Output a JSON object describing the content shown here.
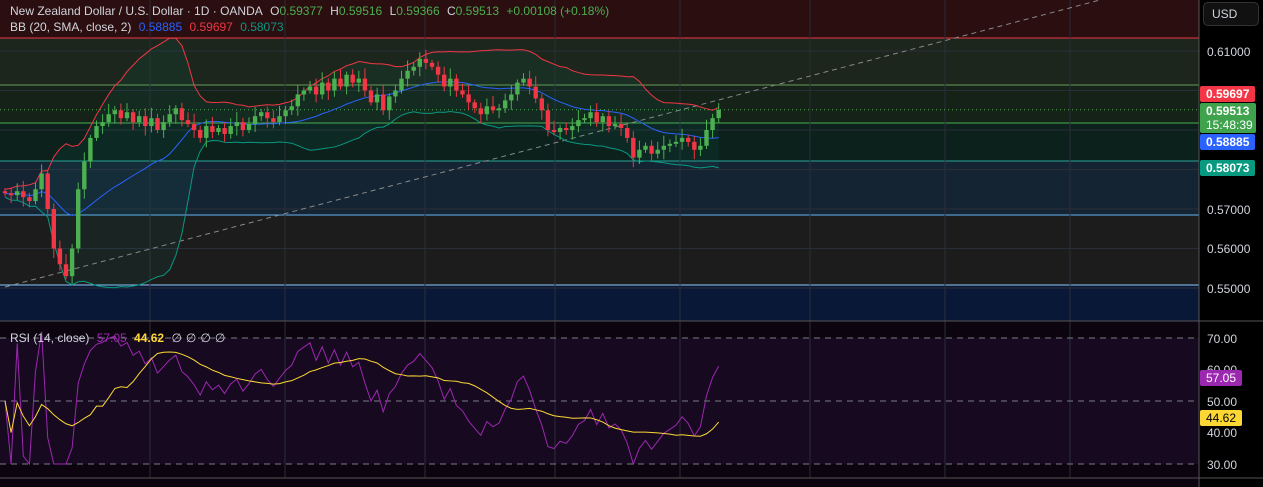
{
  "header": {
    "symbol": "New Zealand Dollar / U.S. Dollar · 1D · OANDA",
    "o_label": "O",
    "o": "0.59377",
    "h_label": "H",
    "h": "0.59516",
    "l_label": "L",
    "l": "0.59366",
    "c_label": "C",
    "c": "0.59513",
    "change": "+0.00108 (+0.18%)"
  },
  "bb": {
    "label": "BB (20, SMA, close, 2)",
    "basis": "0.58885",
    "upper": "0.59697",
    "lower": "0.58073"
  },
  "rsi": {
    "label": "RSI (14, close)",
    "value": "57.05",
    "ma": "44.62",
    "na": [
      "∅",
      "∅",
      "∅",
      "∅"
    ]
  },
  "price_axis": {
    "currency": "USD",
    "ticks": [
      "0.61000",
      "0.57000",
      "0.56000",
      "0.55000"
    ],
    "tags": {
      "upper": "0.59697",
      "close": "0.59513",
      "countdown": "15:48:39",
      "basis": "0.58885",
      "lower": "0.58073"
    }
  },
  "rsi_axis": {
    "ticks": [
      "70.00",
      "60.00",
      "50.00",
      "40.00",
      "30.00"
    ],
    "tags": {
      "rsi": "57.05",
      "ma": "44.62"
    }
  },
  "colors": {
    "up": "#4caf50",
    "down": "#f23645",
    "bb_basis": "#2962ff",
    "bb_upper": "#f23645",
    "bb_lower": "#089981",
    "rsi": "#9c27b0",
    "rsi_ma": "#fdd835"
  },
  "chart_data": {
    "type": "candlestick",
    "closes": [
      0.574,
      0.5735,
      0.5745,
      0.573,
      0.572,
      0.575,
      0.579,
      0.57,
      0.56,
      0.556,
      0.553,
      0.56,
      0.575,
      0.582,
      0.588,
      0.591,
      0.592,
      0.594,
      0.595,
      0.593,
      0.5945,
      0.592,
      0.5935,
      0.591,
      0.593,
      0.59,
      0.592,
      0.594,
      0.5955,
      0.5925,
      0.5915,
      0.59,
      0.588,
      0.591,
      0.5895,
      0.5905,
      0.589,
      0.591,
      0.592,
      0.59,
      0.5915,
      0.5935,
      0.5945,
      0.593,
      0.592,
      0.5935,
      0.595,
      0.596,
      0.599,
      0.6,
      0.601,
      0.599,
      0.602,
      0.6,
      0.603,
      0.601,
      0.604,
      0.602,
      0.603,
      0.6,
      0.597,
      0.599,
      0.595,
      0.5985,
      0.6,
      0.603,
      0.605,
      0.606,
      0.608,
      0.607,
      0.606,
      0.604,
      0.601,
      0.603,
      0.6,
      0.599,
      0.597,
      0.5955,
      0.594,
      0.596,
      0.595,
      0.5955,
      0.5975,
      0.599,
      0.602,
      0.603,
      0.601,
      0.598,
      0.595,
      0.59,
      0.5895,
      0.5905,
      0.59,
      0.591,
      0.5925,
      0.593,
      0.5945,
      0.592,
      0.5935,
      0.591,
      0.5915,
      0.5905,
      0.588,
      0.583,
      0.585,
      0.586,
      0.584,
      0.585,
      0.586,
      0.5865,
      0.587,
      0.588,
      0.587,
      0.585,
      0.586,
      0.59,
      0.593,
      0.5951
    ],
    "price_range": [
      0.5425,
      0.623
    ],
    "rsi_range": [
      25,
      75
    ]
  }
}
